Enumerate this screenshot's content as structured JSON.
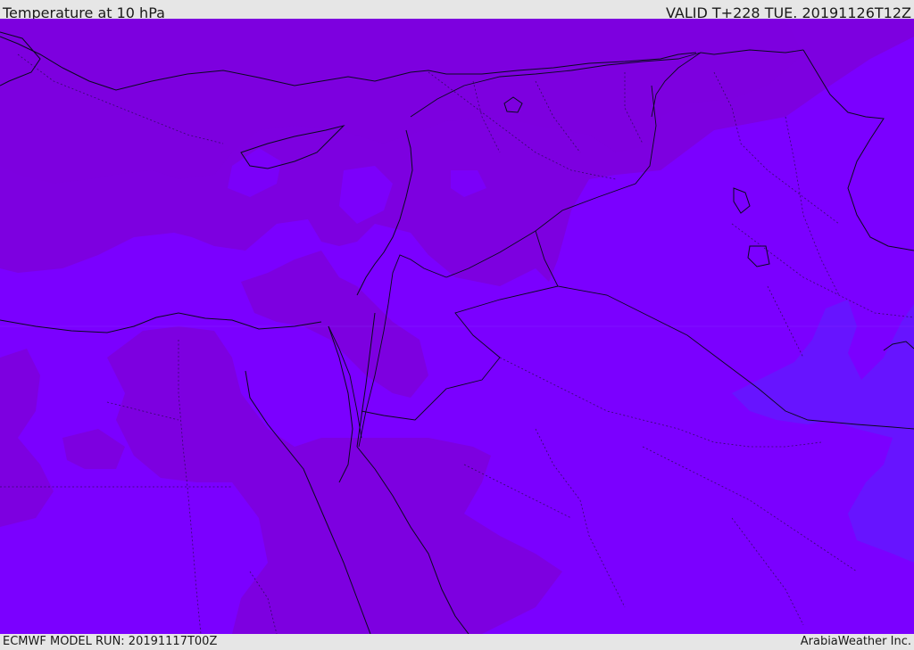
{
  "header": {
    "title": "Temperature at 10 hPa",
    "valid_time": "VALID T+228 TUE. 20191126T12Z"
  },
  "footer": {
    "model_run": "ECMWF MODEL RUN: 20191117T00Z",
    "credit": "ArabiaWeather Inc."
  },
  "map": {
    "base_color": "#7b00ff",
    "warmer_band_color": "#7e00e0",
    "cooler_patch_color": "#6a1aff",
    "outline_color": "#0a0a1e"
  }
}
